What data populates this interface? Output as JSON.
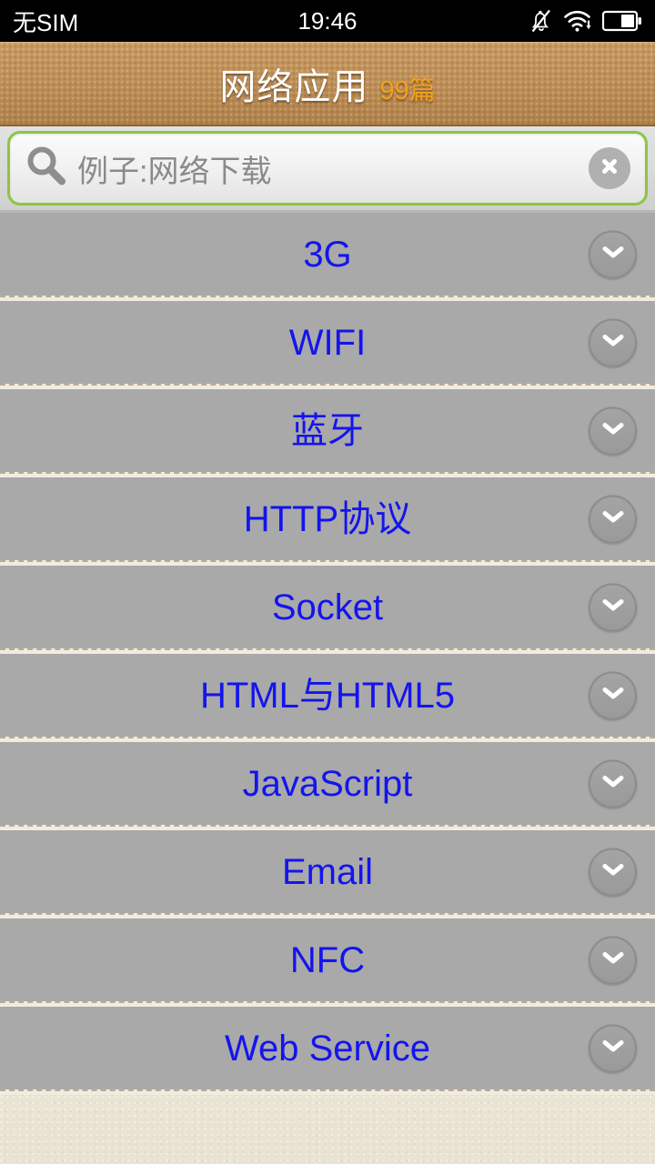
{
  "status_bar": {
    "carrier": "无SIM",
    "time": "19:46",
    "icons": [
      "bell-muted-icon",
      "wifi-download-icon",
      "battery-icon"
    ]
  },
  "header": {
    "title": "网络应用",
    "count": "99篇",
    "title_color": "#ffffff",
    "count_color": "#f4a01c",
    "background_color": "#bd8e55"
  },
  "search": {
    "placeholder": "例子:网络下载",
    "value": "",
    "icon": "search-icon",
    "clear_icon": "clear-circle-icon",
    "border_color": "#8cc63e"
  },
  "list": {
    "row_bg": "#a9a9a9",
    "label_color": "#1414ee",
    "expand_icon": "chevron-down-icon",
    "items": [
      {
        "label": "3G"
      },
      {
        "label": "WIFI"
      },
      {
        "label": "蓝牙"
      },
      {
        "label": "HTTP协议"
      },
      {
        "label": "Socket"
      },
      {
        "label": "HTML与HTML5"
      },
      {
        "label": "JavaScript"
      },
      {
        "label": "Email"
      },
      {
        "label": "NFC"
      },
      {
        "label": "Web Service"
      }
    ]
  }
}
